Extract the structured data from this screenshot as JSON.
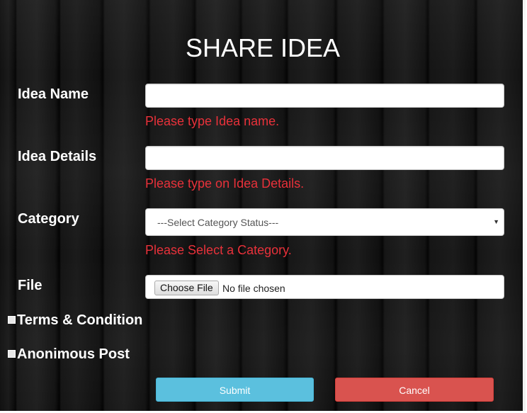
{
  "form": {
    "title": "SHARE IDEA",
    "idea_name": {
      "label": "Idea Name",
      "value": "",
      "error": "Please type Idea name."
    },
    "idea_details": {
      "label": "Idea Details",
      "value": "",
      "error": "Please type on Idea Details."
    },
    "category": {
      "label": "Category",
      "selected": "---Select Category Status---",
      "error": "Please Select a Category."
    },
    "file": {
      "label": "File",
      "button_label": "Choose File",
      "status": "No file chosen"
    },
    "terms": {
      "label": "Terms & Condition",
      "checked": false
    },
    "anonymous": {
      "label": "Anonimous Post",
      "checked": false
    },
    "submit_label": "Submit",
    "cancel_label": "Cancel"
  },
  "colors": {
    "error_text": "#e8313a",
    "submit_bg": "#5bc0de",
    "cancel_bg": "#d9534f"
  },
  "icons": {
    "select_arrow": "chevron-down-icon",
    "checkbox": "checkbox-icon"
  }
}
